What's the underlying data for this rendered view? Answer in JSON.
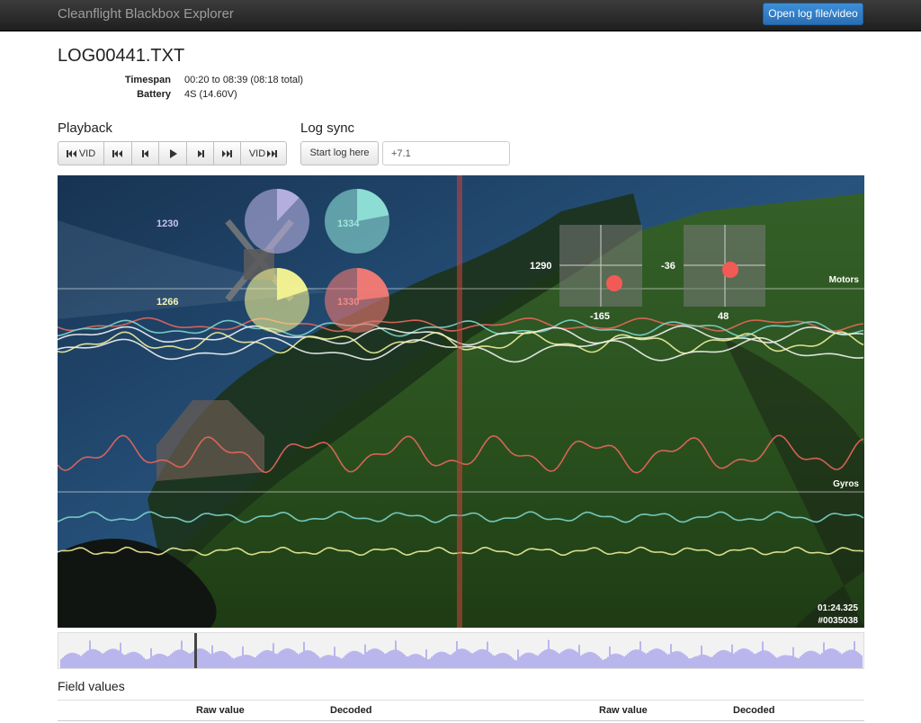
{
  "app": {
    "title": "Cleanflight Blackbox Explorer",
    "open_button": "Open log file/video"
  },
  "log": {
    "filename": "LOG00441.TXT",
    "timespan_label": "Timespan",
    "timespan_value": "00:20 to 08:39 (08:18 total)",
    "battery_label": "Battery",
    "battery_value": "4S (14.60V)"
  },
  "playback": {
    "title": "Playback",
    "buttons": [
      {
        "icon": "skip-back-icon",
        "label": "VID"
      },
      {
        "icon": "skip-start-icon",
        "label": ""
      },
      {
        "icon": "step-back-icon",
        "label": ""
      },
      {
        "icon": "play-icon",
        "label": ""
      },
      {
        "icon": "step-forward-icon",
        "label": ""
      },
      {
        "icon": "skip-end-icon",
        "label": ""
      },
      {
        "icon": "skip-forward-icon",
        "label": "VID"
      }
    ]
  },
  "logsync": {
    "title": "Log sync",
    "start_button": "Start log here",
    "offset_value": "+7.1"
  },
  "graph": {
    "motors": [
      {
        "value": "1230",
        "color": "#b7b0e0",
        "fraction": 0.12
      },
      {
        "value": "1334",
        "color": "#8ee0d6",
        "fraction": 0.22
      },
      {
        "value": "1266",
        "color": "#f3f291",
        "fraction": 0.2
      },
      {
        "value": "1330",
        "color": "#f07a73",
        "fraction": 0.23
      }
    ],
    "sticks": [
      {
        "top_left": "1290",
        "bottom": "-165"
      },
      {
        "top_left": "-36",
        "bottom": "48"
      }
    ],
    "motors_label": "Motors",
    "gyros_label": "Gyros",
    "time": "01:24.325",
    "frame": "#0035038",
    "colors": {
      "red": "#e8675c",
      "teal": "#7ed6cd",
      "yellow": "#f0ef9a",
      "white": "#f2f2f2",
      "cursor": "#c8463c"
    }
  },
  "fields": {
    "title": "Field values",
    "headers": [
      "Raw value",
      "Decoded",
      "Raw value",
      "Decoded"
    ]
  }
}
